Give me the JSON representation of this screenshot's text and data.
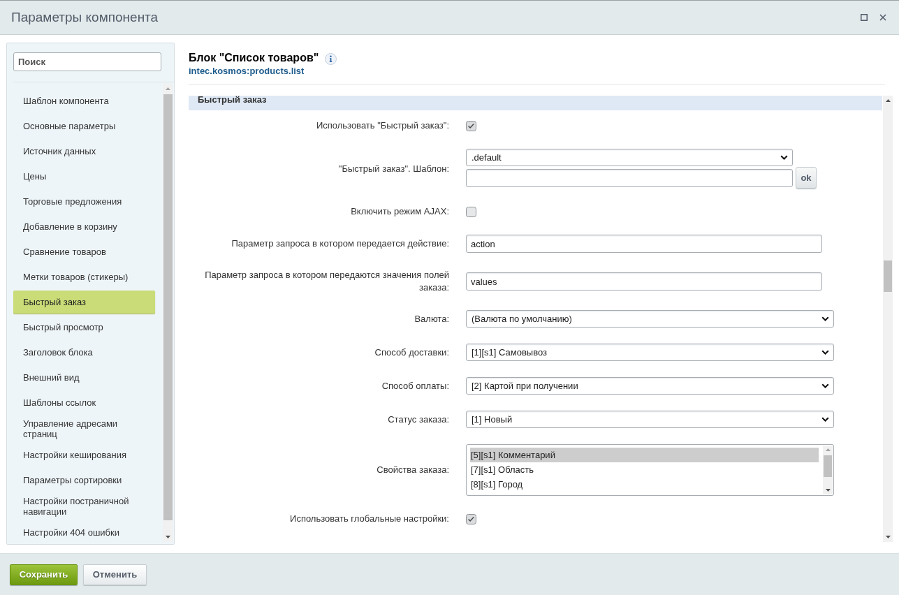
{
  "window": {
    "title": "Параметры компонента"
  },
  "sidebar": {
    "search": {
      "placeholder": "Поиск"
    },
    "items": [
      {
        "label": "Шаблон компонента",
        "selected": false
      },
      {
        "label": "Основные параметры",
        "selected": false
      },
      {
        "label": "Источник данных",
        "selected": false
      },
      {
        "label": "Цены",
        "selected": false
      },
      {
        "label": "Торговые предложения",
        "selected": false
      },
      {
        "label": "Добавление в корзину",
        "selected": false
      },
      {
        "label": "Сравнение товаров",
        "selected": false
      },
      {
        "label": "Метки товаров (стикеры)",
        "selected": false
      },
      {
        "label": "Быстрый заказ",
        "selected": true
      },
      {
        "label": "Быстрый просмотр",
        "selected": false
      },
      {
        "label": "Заголовок блока",
        "selected": false
      },
      {
        "label": "Внешний вид",
        "selected": false
      },
      {
        "label": "Шаблоны ссылок",
        "selected": false
      },
      {
        "label": "Управление адресами страниц",
        "selected": false
      },
      {
        "label": "Настройки кеширования",
        "selected": false
      },
      {
        "label": "Параметры сортировки",
        "selected": false
      },
      {
        "label": "Настройки постраничной навигации",
        "selected": false
      },
      {
        "label": "Настройки 404 ошибки",
        "selected": false
      }
    ]
  },
  "header": {
    "title": "Блок \"Список товаров\"",
    "component_code": "intec.kosmos:products.list"
  },
  "section": {
    "title": "Быстрый заказ",
    "fields": [
      {
        "kind": "checkbox",
        "label": "Использовать \"Быстрый заказ\":",
        "checked": true
      },
      {
        "kind": "template",
        "label": "\"Быстрый заказ\". Шаблон:",
        "value": ".default",
        "button": "ok"
      },
      {
        "kind": "checkbox",
        "label": "Включить режим AJAX:",
        "checked": false
      },
      {
        "kind": "text",
        "label": "Параметр запроса в котором передается действие:",
        "value": "action"
      },
      {
        "kind": "text",
        "label": "Параметр запроса в котором передаются значения полей заказа:",
        "value": "values"
      },
      {
        "kind": "select",
        "label": "Валюта:",
        "value": "(Валюта по умолчанию)"
      },
      {
        "kind": "select",
        "label": "Способ доставки:",
        "value": "[1][s1] Самовывоз"
      },
      {
        "kind": "select",
        "label": "Способ оплаты:",
        "value": "[2] Картой при получении"
      },
      {
        "kind": "select",
        "label": "Статус заказа:",
        "value": "[1] Новый"
      },
      {
        "kind": "listbox",
        "label": "Свойства заказа:",
        "options": [
          {
            "label": "[5][s1] Комментарий",
            "selected": true
          },
          {
            "label": "[7][s1] Область",
            "selected": false
          },
          {
            "label": "[8][s1] Город",
            "selected": false
          }
        ]
      },
      {
        "kind": "checkbox",
        "label": "Использовать глобальные настройки:",
        "checked": true
      }
    ]
  },
  "buttons": [
    {
      "label": "Сохранить",
      "kind": "primary"
    },
    {
      "label": "Отменить",
      "kind": "secondary"
    }
  ]
}
